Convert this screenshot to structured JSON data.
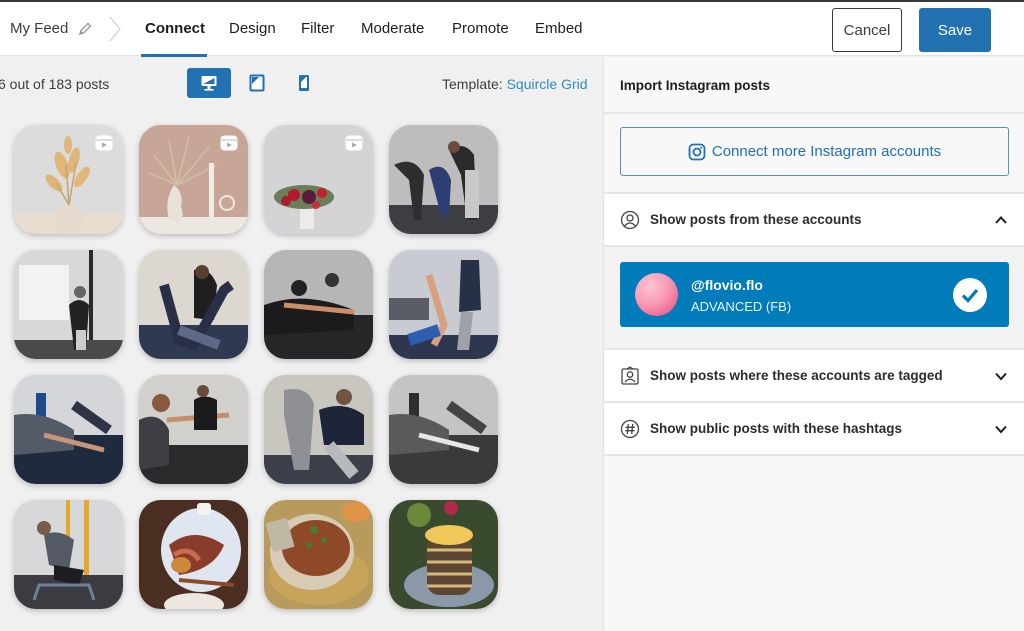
{
  "header": {
    "feed_name": "My Feed",
    "tabs": [
      {
        "label": "Connect",
        "active": true
      },
      {
        "label": "Design",
        "active": false
      },
      {
        "label": "Filter",
        "active": false
      },
      {
        "label": "Moderate",
        "active": false
      },
      {
        "label": "Promote",
        "active": false
      },
      {
        "label": "Embed",
        "active": false
      }
    ],
    "cancel_label": "Cancel",
    "save_label": "Save"
  },
  "toolbar": {
    "post_count": "6 out of 183 posts",
    "devices": [
      "desktop",
      "tablet",
      "phone"
    ],
    "active_device": "desktop",
    "template_label": "Template:",
    "template_value": "Squircle Grid"
  },
  "posts": [
    {
      "subject": "dried pampas flowers in vase",
      "reel": true
    },
    {
      "subject": "palm leaf vase with candle",
      "reel": true
    },
    {
      "subject": "red flower bouquet",
      "reel": true
    },
    {
      "subject": "group stretching in gym",
      "reel": false
    },
    {
      "subject": "coach at whiteboard",
      "reel": false
    },
    {
      "subject": "assisted leg stretch",
      "reel": false
    },
    {
      "subject": "seated forward stretch class",
      "reel": false
    },
    {
      "subject": "trainer assisted leg raise",
      "reel": false
    },
    {
      "subject": "kneeling stretch on bench",
      "reel": false
    },
    {
      "subject": "seated reach stretch",
      "reel": false
    },
    {
      "subject": "coach assisting forward bend",
      "reel": false
    },
    {
      "subject": "black and white stretch class",
      "reel": false
    },
    {
      "subject": "woman on parallettes",
      "reel": false
    },
    {
      "subject": "steak dinner plate",
      "reel": false
    },
    {
      "subject": "chickpea bowl",
      "reel": false
    },
    {
      "subject": "pancake stack with lemon",
      "reel": false
    }
  ],
  "panel": {
    "title": "Import Instagram posts",
    "connect_label": "Connect more Instagram accounts",
    "sections": {
      "accounts": {
        "label": "Show posts from these accounts",
        "expanded": true
      },
      "tagged": {
        "label": "Show posts where these accounts are tagged",
        "expanded": false
      },
      "hashtags": {
        "label": "Show public posts with these hashtags",
        "expanded": false
      }
    },
    "account": {
      "handle": "@flovio.flo",
      "type": "ADVANCED (FB)",
      "selected": true
    }
  },
  "colors": {
    "accent": "#2271b1",
    "account_card": "#007cba",
    "link": "#2c8bc8"
  }
}
